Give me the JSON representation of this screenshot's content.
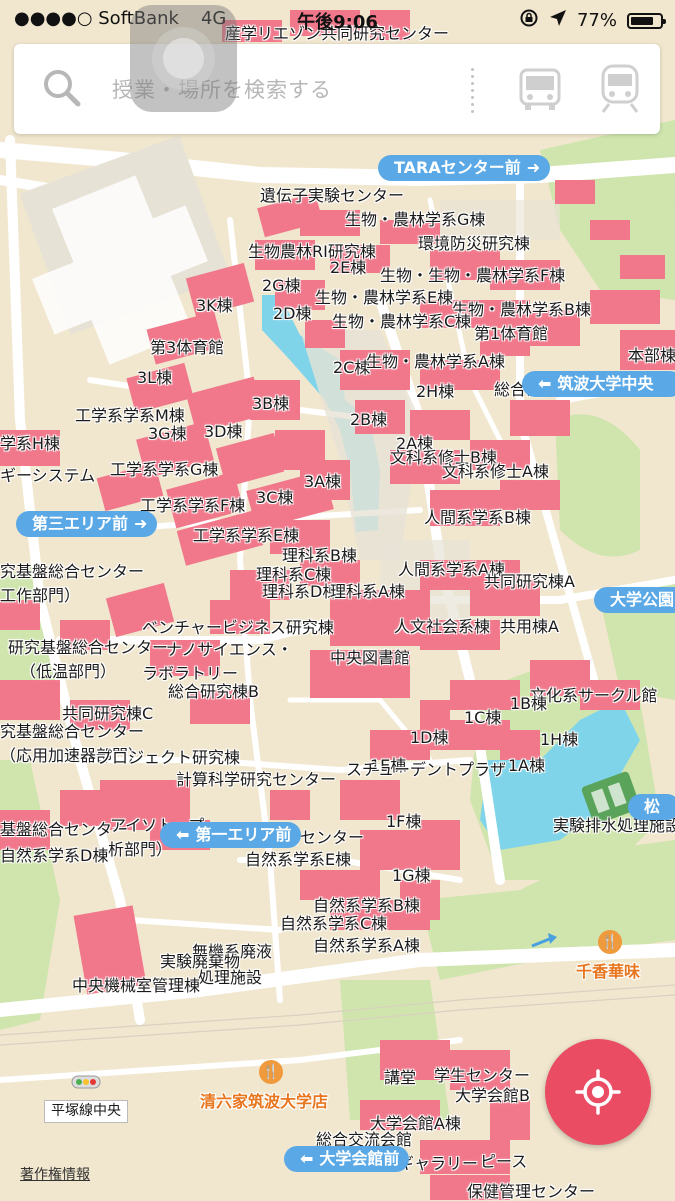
{
  "status_bar": {
    "carrier": "●●●●○ SoftBank",
    "network": "4G",
    "time": "午後9:06",
    "battery": "77%",
    "battery_level": 0.77
  },
  "search": {
    "placeholder": "授業・場所を検索する"
  },
  "bus_stops": [
    {
      "label": "TARAセンター前"
    },
    {
      "label": "第三エリア前"
    },
    {
      "label": "筑波大学中央"
    },
    {
      "label": "大学公園"
    },
    {
      "label": "第一エリア前"
    },
    {
      "label": "大学会館前"
    },
    {
      "label": "松"
    }
  ],
  "places": [
    "産学リエゾン共同研究センター",
    "遺伝子実験センター",
    "生物・農林学系G棟",
    "環境防災研究棟",
    "生物農林RI研究棟",
    "2E棟",
    "生物・生物・農林学系F棟",
    "2G棟",
    "生物・農林学系E棟",
    "生物・農林学系B棟",
    "3K棟",
    "2D棟",
    "生物・農林学系C棟",
    "第1体育館",
    "第3体育館",
    "2C棟",
    "生物・農林学系A棟",
    "本部棟",
    "3L棟",
    "2H棟",
    "総合研究棟A",
    "3B棟",
    "工学系学系M棟",
    "2B棟",
    "3G棟",
    "3D棟",
    "2A棟",
    "文科系修士B棟",
    "学系H棟",
    "ギーシステム",
    "工学系学系G棟",
    "文科系修士A棟",
    "3A棟",
    "3C棟",
    "工学系学系F棟",
    "人間系学系B棟",
    "工学系学系E棟",
    "理科系B棟",
    "人間系学系A棟",
    "究基盤総合センター",
    "理科系C棟",
    "共同研究棟A",
    "工作部門）",
    "理科系D棟",
    "理科系A棟",
    "ベンチャービジネス研究棟",
    "人文社会系棟",
    "共用棟A",
    "研究基盤総合センター",
    "（低温部門）",
    "ナノサイエンス・",
    "ラボラトリー",
    "中央図書館",
    "総合研究棟B",
    "文化系サークル館",
    "共同研究棟C",
    "1C棟",
    "1B棟",
    "究基盤総合センター",
    "1D棟",
    "1H棟",
    "（応用加速器部門）",
    "プロジェクト研究棟",
    "1E棟",
    "スチューデントプラザ",
    "1A棟",
    "計算科学研究センター",
    "基盤総合センター",
    "アイソトープ",
    "1F棟",
    "実験排水処理施設",
    "自然系学系D棟",
    "析部門）",
    "総合センター",
    "自然系学系E棟",
    "1G棟",
    "自然系学系B棟",
    "自然系学系C棟",
    "無機系廃液",
    "自然系学系A棟",
    "実験廃棄物",
    "処理施設",
    "中央機械室管理棟",
    "講堂",
    "学生センター",
    "大学会館B",
    "大学会館A棟",
    "総合交流会館",
    "筑波大学ギャラリー",
    "ピース",
    "保健管理センター",
    "平塚線中央"
  ],
  "restaurants": [
    {
      "label": "千香華味"
    },
    {
      "label": "清六家筑波大学店"
    }
  ],
  "footer": {
    "copyright": "著作権情報"
  },
  "icons": {
    "search": "search-icon",
    "bus": "bus-icon",
    "train": "train-icon",
    "locate": "crosshair-icon"
  },
  "colors": {
    "building": "#f1788b",
    "map_bg": "#f1e7cf",
    "road": "#ffffff",
    "water": "#7fd4ea",
    "park": "#c9e2a8",
    "bus_stop": "#5aa9e6",
    "locate_button": "#e94c63"
  }
}
